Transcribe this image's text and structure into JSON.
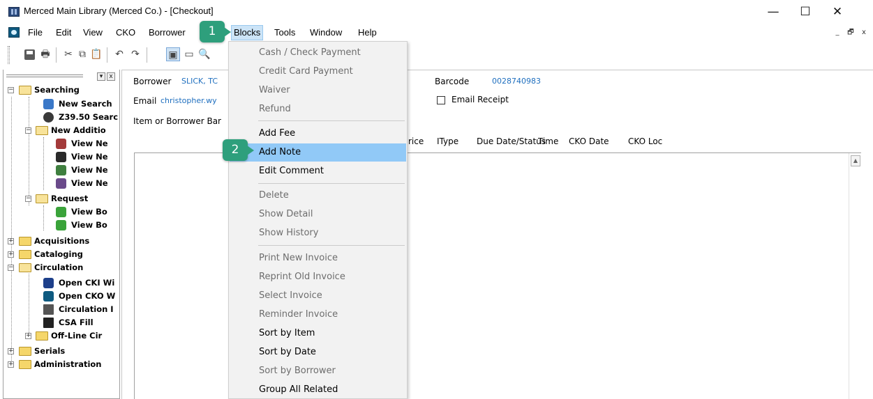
{
  "window": {
    "title": "Merced Main Library (Merced Co.) - [Checkout]",
    "controls": {
      "minimize": "—",
      "maximize": "☐",
      "close": "✕"
    }
  },
  "menubar": {
    "items": [
      "File",
      "Edit",
      "View",
      "CKO",
      "Borrower",
      "Blocks",
      "Tools",
      "Window",
      "Help"
    ],
    "active": "Blocks",
    "mdi_controls": {
      "minimize": "_",
      "restore": "🗗",
      "close": "x"
    }
  },
  "toolbar": {
    "icons": [
      "save-icon",
      "print-icon",
      "cut-icon",
      "copy-icon",
      "paste-icon",
      "undo-icon",
      "redo-icon",
      "window-icon",
      "window-tile-icon",
      "search-window-icon"
    ]
  },
  "tree": {
    "nodes": [
      {
        "label": "Searching",
        "icon": "folder-open-icon",
        "level": 0,
        "expander": "−"
      },
      {
        "label": "New Search",
        "icon": "search-icon",
        "level": 1
      },
      {
        "label": "Z39.50 Searc",
        "icon": "z3950-icon",
        "level": 1
      },
      {
        "label": "New Additio",
        "icon": "folder-open-icon",
        "level": 1,
        "expander": "−"
      },
      {
        "label": "View Ne",
        "icon": "view-icon",
        "level": 2
      },
      {
        "label": "View Ne",
        "icon": "view-icon",
        "level": 2
      },
      {
        "label": "View Ne",
        "icon": "view-icon",
        "level": 2
      },
      {
        "label": "View Ne",
        "icon": "view-icon",
        "level": 2
      },
      {
        "label": "Request",
        "icon": "folder-open-icon",
        "level": 1,
        "expander": "−"
      },
      {
        "label": "View Bo",
        "icon": "request-icon",
        "level": 2
      },
      {
        "label": "View Bo",
        "icon": "request-icon",
        "level": 2
      },
      {
        "label": "Acquisitions",
        "icon": "folder-icon",
        "level": 0,
        "expander": "+"
      },
      {
        "label": "Cataloging",
        "icon": "folder-icon",
        "level": 0,
        "expander": "+"
      },
      {
        "label": "Circulation",
        "icon": "folder-open-icon",
        "level": 0,
        "expander": "−"
      },
      {
        "label": "Open CKI Wi",
        "icon": "cki-icon",
        "level": 1
      },
      {
        "label": "Open CKO W",
        "icon": "cko-icon",
        "level": 1
      },
      {
        "label": "Circulation I",
        "icon": "circulation-icon",
        "level": 1
      },
      {
        "label": "CSA Fill",
        "icon": "csa-icon",
        "level": 1
      },
      {
        "label": "Off-Line Cir",
        "icon": "folder-icon",
        "level": 1,
        "expander": "+"
      },
      {
        "label": "Serials",
        "icon": "folder-icon",
        "level": 0,
        "expander": "+"
      },
      {
        "label": "Administration",
        "icon": "folder-icon",
        "level": 0,
        "expander": "+"
      }
    ]
  },
  "checkout": {
    "borrower_label": "Borrower",
    "borrower_value": "SLICK, TC",
    "email_label": "Email",
    "email_value": "christopher.wy",
    "item_label": "Item or Borrower Bar",
    "barcode_label": "Barcode",
    "barcode_value": "0028740983",
    "email_receipt_label": "Email Receipt",
    "columns": [
      "rice",
      "IType",
      "Due Date/Status",
      "Time",
      "CKO Date",
      "CKO Loc"
    ]
  },
  "blocks_menu": {
    "items": [
      {
        "label": "Cash / Check Payment",
        "enabled": false
      },
      {
        "label": "Credit Card Payment",
        "enabled": false
      },
      {
        "label": "Waiver",
        "enabled": false
      },
      {
        "label": "Refund",
        "enabled": false
      },
      {
        "separator": true
      },
      {
        "label": "Add Fee",
        "enabled": true
      },
      {
        "label": "Add Note",
        "enabled": true,
        "highlighted": true
      },
      {
        "label": "Edit Comment",
        "enabled": true
      },
      {
        "separator": true
      },
      {
        "label": "Delete",
        "enabled": false
      },
      {
        "label": "Show Detail",
        "enabled": false
      },
      {
        "label": "Show History",
        "enabled": false
      },
      {
        "separator": true
      },
      {
        "label": "Print New Invoice",
        "enabled": false
      },
      {
        "label": "Reprint Old Invoice",
        "enabled": false
      },
      {
        "label": "Select Invoice",
        "enabled": false
      },
      {
        "label": "Reminder Invoice",
        "enabled": false
      },
      {
        "label": "Sort by Item",
        "enabled": true
      },
      {
        "label": "Sort by Date",
        "enabled": true
      },
      {
        "label": "Sort by Borrower",
        "enabled": false
      },
      {
        "label": "Group All Related",
        "enabled": true
      }
    ]
  },
  "callouts": [
    "1",
    "2"
  ],
  "colors": {
    "callout": "#2e9f7c",
    "highlight": "#91c9f7",
    "link_value": "#1f6fbf",
    "menu_active": "#cce4f7"
  }
}
